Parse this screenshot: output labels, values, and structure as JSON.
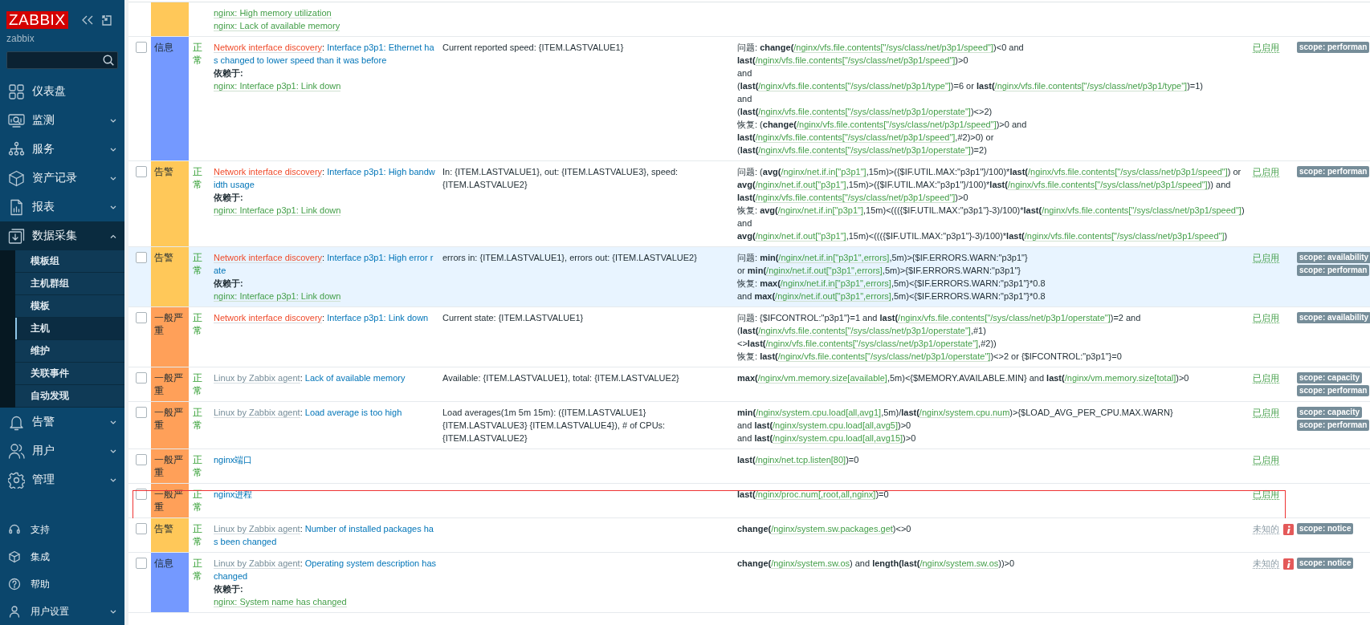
{
  "sidebar": {
    "logo": "ZABBIX",
    "server": "zabbix",
    "menu": [
      {
        "label": "仪表盘"
      },
      {
        "label": "监测",
        "expanded": false
      },
      {
        "label": "服务",
        "expanded": false
      },
      {
        "label": "资产记录",
        "expanded": false
      },
      {
        "label": "报表",
        "expanded": false
      },
      {
        "label": "数据采集",
        "expanded": true,
        "children": [
          {
            "label": "模板组",
            "selected": false
          },
          {
            "label": "主机群组",
            "selected": false
          },
          {
            "label": "模板",
            "selected": false
          },
          {
            "label": "主机",
            "selected": true
          },
          {
            "label": "维护",
            "selected": false
          },
          {
            "label": "关联事件",
            "selected": false
          },
          {
            "label": "自动发现",
            "selected": false
          }
        ]
      },
      {
        "label": "告警",
        "expanded": false
      },
      {
        "label": "用户",
        "expanded": false
      },
      {
        "label": "管理",
        "expanded": false
      }
    ],
    "bottom": [
      {
        "label": "支持"
      },
      {
        "label": "集成"
      },
      {
        "label": "帮助"
      },
      {
        "label": "用户设置",
        "expanded": false
      }
    ]
  },
  "triggers": [
    {
      "hovered": false,
      "outlined": false,
      "severity": {
        "color": "#ffc859"
      },
      "dependencies": [
        "nginx: High memory utilization",
        "nginx: Lack of available memory"
      ]
    },
    {
      "checked": false,
      "hovered": false,
      "outlined": false,
      "severity": {
        "label": "信息",
        "color": "#7499ff"
      },
      "status": "正常",
      "template": {
        "text": "Network interface discovery",
        "color": "#ef4b2b"
      },
      "separator": ":",
      "name": "Interface p3p1: Ethernet has changed to lower speed than it was before",
      "depends_label": "依赖于:",
      "dependencies": [
        "nginx: Interface p3p1: Link down"
      ],
      "opdata": "Current reported speed: {ITEM.LASTVALUE1}",
      "expression": [
        [
          {
            "kind": "text",
            "text": "问题: "
          },
          {
            "kind": "fn",
            "text": "change("
          },
          {
            "kind": "item",
            "text": "/nginx/vfs.file.contents[\"/sys/class/net/p3p1/speed\"]"
          },
          {
            "kind": "text",
            "text": ")<0 and"
          }
        ],
        [
          {
            "kind": "fn",
            "text": "last("
          },
          {
            "kind": "item",
            "text": "/nginx/vfs.file.contents[\"/sys/class/net/p3p1/speed\"]"
          },
          {
            "kind": "text",
            "text": ")>0"
          }
        ],
        [
          {
            "kind": "text",
            "text": "and"
          }
        ],
        [
          {
            "kind": "text",
            "text": "("
          },
          {
            "kind": "fn",
            "text": "last("
          },
          {
            "kind": "item",
            "text": "/nginx/vfs.file.contents[\"/sys/class/net/p3p1/type\"]"
          },
          {
            "kind": "text",
            "text": ")=6 or "
          },
          {
            "kind": "fn",
            "text": "last("
          },
          {
            "kind": "item",
            "text": "/nginx/vfs.file.contents[\"/sys/class/net/p3p1/type\"]"
          },
          {
            "kind": "text",
            "text": ")=1)"
          }
        ],
        [
          {
            "kind": "text",
            "text": "and"
          }
        ],
        [
          {
            "kind": "text",
            "text": "("
          },
          {
            "kind": "fn",
            "text": "last("
          },
          {
            "kind": "item",
            "text": "/nginx/vfs.file.contents[\"/sys/class/net/p3p1/operstate\"]"
          },
          {
            "kind": "text",
            "text": ")<>2)"
          }
        ],
        [
          {
            "kind": "text",
            "text": "恢复: ("
          },
          {
            "kind": "fn",
            "text": "change("
          },
          {
            "kind": "item",
            "text": "/nginx/vfs.file.contents[\"/sys/class/net/p3p1/speed\"]"
          },
          {
            "kind": "text",
            "text": ")>0 and"
          }
        ],
        [
          {
            "kind": "fn",
            "text": "last("
          },
          {
            "kind": "item",
            "text": "/nginx/vfs.file.contents[\"/sys/class/net/p3p1/speed\"]"
          },
          {
            "kind": "text",
            "text": ",#2)>0) or"
          }
        ],
        [
          {
            "kind": "text",
            "text": "("
          },
          {
            "kind": "fn",
            "text": "last("
          },
          {
            "kind": "item",
            "text": "/nginx/vfs.file.contents[\"/sys/class/net/p3p1/operstate\"]"
          },
          {
            "kind": "text",
            "text": ")=2)"
          }
        ]
      ],
      "state": {
        "text": "已启用",
        "kind": "enabled"
      },
      "info_icon": false,
      "tags": [
        "scope: performan"
      ]
    },
    {
      "checked": false,
      "hovered": false,
      "outlined": false,
      "severity": {
        "label": "告警",
        "color": "#ffc859"
      },
      "status": "正常",
      "template": {
        "text": "Network interface discovery",
        "color": "#ef4b2b"
      },
      "separator": ":",
      "name": "Interface p3p1: High bandwidth usage",
      "depends_label": "依赖于:",
      "dependencies": [
        "nginx: Interface p3p1: Link down"
      ],
      "opdata": "In: {ITEM.LASTVALUE1}, out: {ITEM.LASTVALUE3}, speed: {ITEM.LASTVALUE2}",
      "expression": [
        [
          {
            "kind": "text",
            "text": "问题: ("
          },
          {
            "kind": "fn",
            "text": "avg("
          },
          {
            "kind": "item",
            "text": "/nginx/net.if.in[\"p3p1\"]"
          },
          {
            "kind": "text",
            "text": ",15m)>({$IF.UTIL.MAX:\"p3p1\"}/100)*"
          },
          {
            "kind": "fn",
            "text": "last("
          },
          {
            "kind": "item",
            "text": "/nginx/vfs.file.contents[\"/sys/class/net/p3p1/speed\"]"
          },
          {
            "kind": "text",
            "text": ") or"
          }
        ],
        [
          {
            "kind": "fn",
            "text": "avg("
          },
          {
            "kind": "item",
            "text": "/nginx/net.if.out[\"p3p1\"]"
          },
          {
            "kind": "text",
            "text": ",15m)>({$IF.UTIL.MAX:\"p3p1\"}/100)*"
          },
          {
            "kind": "fn",
            "text": "last("
          },
          {
            "kind": "item",
            "text": "/nginx/vfs.file.contents[\"/sys/class/net/p3p1/speed\"]"
          },
          {
            "kind": "text",
            "text": ")) and"
          }
        ],
        [
          {
            "kind": "fn",
            "text": "last("
          },
          {
            "kind": "item",
            "text": "/nginx/vfs.file.contents[\"/sys/class/net/p3p1/speed\"]"
          },
          {
            "kind": "text",
            "text": ")>0"
          }
        ],
        [
          {
            "kind": "text",
            "text": "恢复: "
          },
          {
            "kind": "fn",
            "text": "avg("
          },
          {
            "kind": "item",
            "text": "/nginx/net.if.in[\"p3p1\"]"
          },
          {
            "kind": "text",
            "text": ",15m)<((({$IF.UTIL.MAX:\"p3p1\"}-3)/100)*"
          },
          {
            "kind": "fn",
            "text": "last("
          },
          {
            "kind": "item",
            "text": "/nginx/vfs.file.contents[\"/sys/class/net/p3p1/speed\"]"
          },
          {
            "kind": "text",
            "text": ")"
          }
        ],
        [
          {
            "kind": "text",
            "text": "and"
          }
        ],
        [
          {
            "kind": "fn",
            "text": "avg("
          },
          {
            "kind": "item",
            "text": "/nginx/net.if.out[\"p3p1\"]"
          },
          {
            "kind": "text",
            "text": ",15m)<((({$IF.UTIL.MAX:\"p3p1\"}-3)/100)*"
          },
          {
            "kind": "fn",
            "text": "last("
          },
          {
            "kind": "item",
            "text": "/nginx/vfs.file.contents[\"/sys/class/net/p3p1/speed\"]"
          },
          {
            "kind": "text",
            "text": ")"
          }
        ]
      ],
      "state": {
        "text": "已启用",
        "kind": "enabled"
      },
      "info_icon": false,
      "tags": [
        "scope: performan"
      ]
    },
    {
      "checked": false,
      "hovered": true,
      "outlined": false,
      "severity": {
        "label": "告警",
        "color": "#ffc859"
      },
      "status": "正常",
      "template": {
        "text": "Network interface discovery",
        "color": "#ef4b2b"
      },
      "separator": ":",
      "name": "Interface p3p1: High error rate",
      "depends_label": "依赖于:",
      "dependencies": [
        "nginx: Interface p3p1: Link down"
      ],
      "opdata": "errors in: {ITEM.LASTVALUE1}, errors out: {ITEM.LASTVALUE2}",
      "expression": [
        [
          {
            "kind": "text",
            "text": "问题: "
          },
          {
            "kind": "fn",
            "text": "min("
          },
          {
            "kind": "item",
            "text": "/nginx/net.if.in[\"p3p1\",errors]"
          },
          {
            "kind": "text",
            "text": ",5m)>{$IF.ERRORS.WARN:\"p3p1\"}"
          }
        ],
        [
          {
            "kind": "text",
            "text": "or "
          },
          {
            "kind": "fn",
            "text": "min("
          },
          {
            "kind": "item",
            "text": "/nginx/net.if.out[\"p3p1\",errors]"
          },
          {
            "kind": "text",
            "text": ",5m)>{$IF.ERRORS.WARN:\"p3p1\"}"
          }
        ],
        [
          {
            "kind": "text",
            "text": "恢复: "
          },
          {
            "kind": "fn",
            "text": "max("
          },
          {
            "kind": "item",
            "text": "/nginx/net.if.in[\"p3p1\",errors]"
          },
          {
            "kind": "text",
            "text": ",5m)<{$IF.ERRORS.WARN:\"p3p1\"}*0.8"
          }
        ],
        [
          {
            "kind": "text",
            "text": "and "
          },
          {
            "kind": "fn",
            "text": "max("
          },
          {
            "kind": "item",
            "text": "/nginx/net.if.out[\"p3p1\",errors]"
          },
          {
            "kind": "text",
            "text": ",5m)<{$IF.ERRORS.WARN:\"p3p1\"}*0.8"
          }
        ]
      ],
      "state": {
        "text": "已启用",
        "kind": "enabled"
      },
      "info_icon": false,
      "tags": [
        "scope: availability",
        "scope: performan"
      ]
    },
    {
      "checked": false,
      "hovered": false,
      "outlined": false,
      "severity": {
        "label": "一般严重",
        "color": "#ffa059"
      },
      "status": "正常",
      "template": {
        "text": "Network interface discovery",
        "color": "#ef4b2b"
      },
      "separator": ":",
      "name": "Interface p3p1: Link down",
      "opdata": "Current state: {ITEM.LASTVALUE1}",
      "expression": [
        [
          {
            "kind": "text",
            "text": "问题: {$IFCONTROL:\"p3p1\"}=1 and "
          },
          {
            "kind": "fn",
            "text": "last("
          },
          {
            "kind": "item",
            "text": "/nginx/vfs.file.contents[\"/sys/class/net/p3p1/operstate\"]"
          },
          {
            "kind": "text",
            "text": ")=2 and"
          }
        ],
        [
          {
            "kind": "text",
            "text": "("
          },
          {
            "kind": "fn",
            "text": "last("
          },
          {
            "kind": "item",
            "text": "/nginx/vfs.file.contents[\"/sys/class/net/p3p1/operstate\"]"
          },
          {
            "kind": "text",
            "text": ",#1)"
          }
        ],
        [
          {
            "kind": "text",
            "text": "<>"
          },
          {
            "kind": "fn",
            "text": "last("
          },
          {
            "kind": "item",
            "text": "/nginx/vfs.file.contents[\"/sys/class/net/p3p1/operstate\"]"
          },
          {
            "kind": "text",
            "text": ",#2))"
          }
        ],
        [
          {
            "kind": "text",
            "text": "恢复: "
          },
          {
            "kind": "fn",
            "text": "last("
          },
          {
            "kind": "item",
            "text": "/nginx/vfs.file.contents[\"/sys/class/net/p3p1/operstate\"]"
          },
          {
            "kind": "text",
            "text": ")<>2 or {$IFCONTROL:\"p3p1\"}=0"
          }
        ]
      ],
      "state": {
        "text": "已启用",
        "kind": "enabled"
      },
      "info_icon": false,
      "tags": [
        "scope: availability"
      ]
    },
    {
      "checked": false,
      "hovered": false,
      "outlined": false,
      "severity": {
        "label": "一般严重",
        "color": "#ffa059"
      },
      "status": "正常",
      "template": {
        "text": "Linux by Zabbix agent",
        "color": "#768d99"
      },
      "separator": ":",
      "name": "Lack of available memory",
      "opdata": "Available: {ITEM.LASTVALUE1}, total: {ITEM.LASTVALUE2}",
      "expression": [
        [
          {
            "kind": "fn",
            "text": "max("
          },
          {
            "kind": "item",
            "text": "/nginx/vm.memory.size[available]"
          },
          {
            "kind": "text",
            "text": ",5m)<{$MEMORY.AVAILABLE.MIN} and "
          },
          {
            "kind": "fn",
            "text": "last("
          },
          {
            "kind": "item",
            "text": "/nginx/vm.memory.size[total]"
          },
          {
            "kind": "text",
            "text": ")>0"
          }
        ]
      ],
      "state": {
        "text": "已启用",
        "kind": "enabled"
      },
      "info_icon": false,
      "tags": [
        "scope: capacity",
        "scope: performan"
      ]
    },
    {
      "checked": false,
      "hovered": false,
      "outlined": false,
      "severity": {
        "label": "一般严重",
        "color": "#ffa059"
      },
      "status": "正常",
      "template": {
        "text": "Linux by Zabbix agent",
        "color": "#768d99"
      },
      "separator": ":",
      "name": "Load average is too high",
      "opdata": "Load averages(1m 5m 15m): ({ITEM.LASTVALUE1} {ITEM.LASTVALUE3} {ITEM.LASTVALUE4}), # of CPUs: {ITEM.LASTVALUE2}",
      "expression": [
        [
          {
            "kind": "fn",
            "text": "min("
          },
          {
            "kind": "item",
            "text": "/nginx/system.cpu.load[all,avg1]"
          },
          {
            "kind": "text",
            "text": ",5m)/"
          },
          {
            "kind": "fn",
            "text": "last("
          },
          {
            "kind": "item",
            "text": "/nginx/system.cpu.num"
          },
          {
            "kind": "text",
            "text": ")>{$LOAD_AVG_PER_CPU.MAX.WARN}"
          }
        ],
        [
          {
            "kind": "text",
            "text": "and "
          },
          {
            "kind": "fn",
            "text": "last("
          },
          {
            "kind": "item",
            "text": "/nginx/system.cpu.load[all,avg5]"
          },
          {
            "kind": "text",
            "text": ")>0"
          }
        ],
        [
          {
            "kind": "text",
            "text": "and "
          },
          {
            "kind": "fn",
            "text": "last("
          },
          {
            "kind": "item",
            "text": "/nginx/system.cpu.load[all,avg15]"
          },
          {
            "kind": "text",
            "text": ")>0"
          }
        ]
      ],
      "state": {
        "text": "已启用",
        "kind": "enabled"
      },
      "info_icon": false,
      "tags": [
        "scope: capacity",
        "scope: performan"
      ]
    },
    {
      "checked": false,
      "hovered": false,
      "outlined": false,
      "severity": {
        "label": "一般严重",
        "color": "#ffa059"
      },
      "status": "正常",
      "name": "nginx端口",
      "expression": [
        [
          {
            "kind": "fn",
            "text": "last("
          },
          {
            "kind": "item",
            "text": "/nginx/net.tcp.listen[80]"
          },
          {
            "kind": "text",
            "text": ")=0"
          }
        ]
      ],
      "state": {
        "text": "已启用",
        "kind": "enabled"
      },
      "info_icon": false
    },
    {
      "checked": false,
      "hovered": false,
      "outlined": true,
      "severity": {
        "label": "一般严重",
        "color": "#ffa059"
      },
      "status": "正常",
      "name": "nginx进程",
      "expression": [
        [
          {
            "kind": "fn",
            "text": "last("
          },
          {
            "kind": "item",
            "text": "/nginx/proc.num[,root,all,nginx]"
          },
          {
            "kind": "text",
            "text": ")=0"
          }
        ]
      ],
      "state": {
        "text": "已启用",
        "kind": "enabled"
      },
      "info_icon": false
    },
    {
      "checked": false,
      "hovered": false,
      "outlined": false,
      "severity": {
        "label": "告警",
        "color": "#ffc859"
      },
      "status": "正常",
      "template": {
        "text": "Linux by Zabbix agent",
        "color": "#768d99"
      },
      "separator": ":",
      "name": "Number of installed packages has been changed",
      "expression": [
        [
          {
            "kind": "fn",
            "text": "change("
          },
          {
            "kind": "item",
            "text": "/nginx/system.sw.packages.get"
          },
          {
            "kind": "text",
            "text": ")<>0"
          }
        ]
      ],
      "state": {
        "text": "未知的",
        "kind": "unknown"
      },
      "info_icon": true,
      "tags": [
        "scope: notice"
      ]
    },
    {
      "checked": false,
      "hovered": false,
      "outlined": false,
      "severity": {
        "label": "信息",
        "color": "#7499ff"
      },
      "status": "正常",
      "template": {
        "text": "Linux by Zabbix agent",
        "color": "#768d99"
      },
      "separator": ":",
      "name": "Operating system description has changed",
      "depends_label": "依赖于:",
      "dependencies": [
        "nginx: System name has changed"
      ],
      "expression": [
        [
          {
            "kind": "fn",
            "text": "change("
          },
          {
            "kind": "item",
            "text": "/nginx/system.sw.os"
          },
          {
            "kind": "text",
            "text": ") and "
          },
          {
            "kind": "fn",
            "text": "length(last("
          },
          {
            "kind": "item",
            "text": "/nginx/system.sw.os"
          },
          {
            "kind": "text",
            "text": "))>0"
          }
        ]
      ],
      "state": {
        "text": "未知的",
        "kind": "unknown"
      },
      "info_icon": true,
      "tags": [
        "scope: notice"
      ]
    }
  ]
}
